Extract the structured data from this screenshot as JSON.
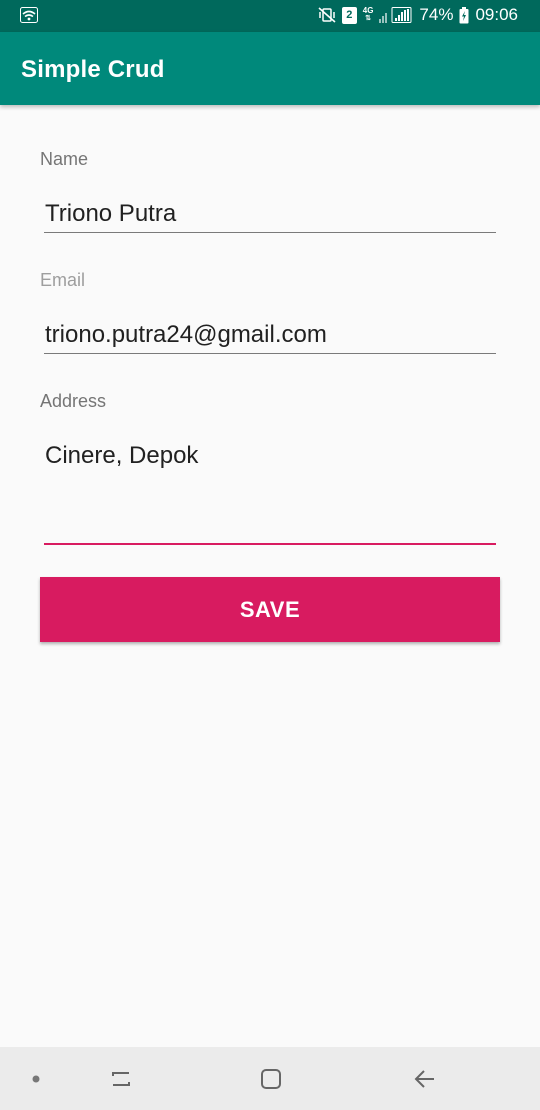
{
  "status_bar": {
    "sim_slot": "2",
    "network_type": "4G",
    "battery_percent": "74%",
    "time": "09:06",
    "icons": [
      "wifi-icon",
      "mute-vibrate-icon",
      "sim-icon",
      "signal-icon",
      "battery-icon"
    ]
  },
  "app_bar": {
    "title": "Simple Crud"
  },
  "form": {
    "name": {
      "label": "Name",
      "value": "Triono Putra"
    },
    "email": {
      "label": "Email",
      "value": "triono.putra24@gmail.com"
    },
    "address": {
      "label": "Address",
      "value": "Cinere, Depok"
    },
    "save_label": "SAVE"
  },
  "nav_bar": {
    "buttons": [
      "dot-indicator-icon",
      "recent-apps-icon",
      "home-icon",
      "back-icon"
    ]
  },
  "colors": {
    "status_bar": "#00695c",
    "app_bar": "#00897b",
    "accent": "#d81b60",
    "background": "#fafafa"
  }
}
